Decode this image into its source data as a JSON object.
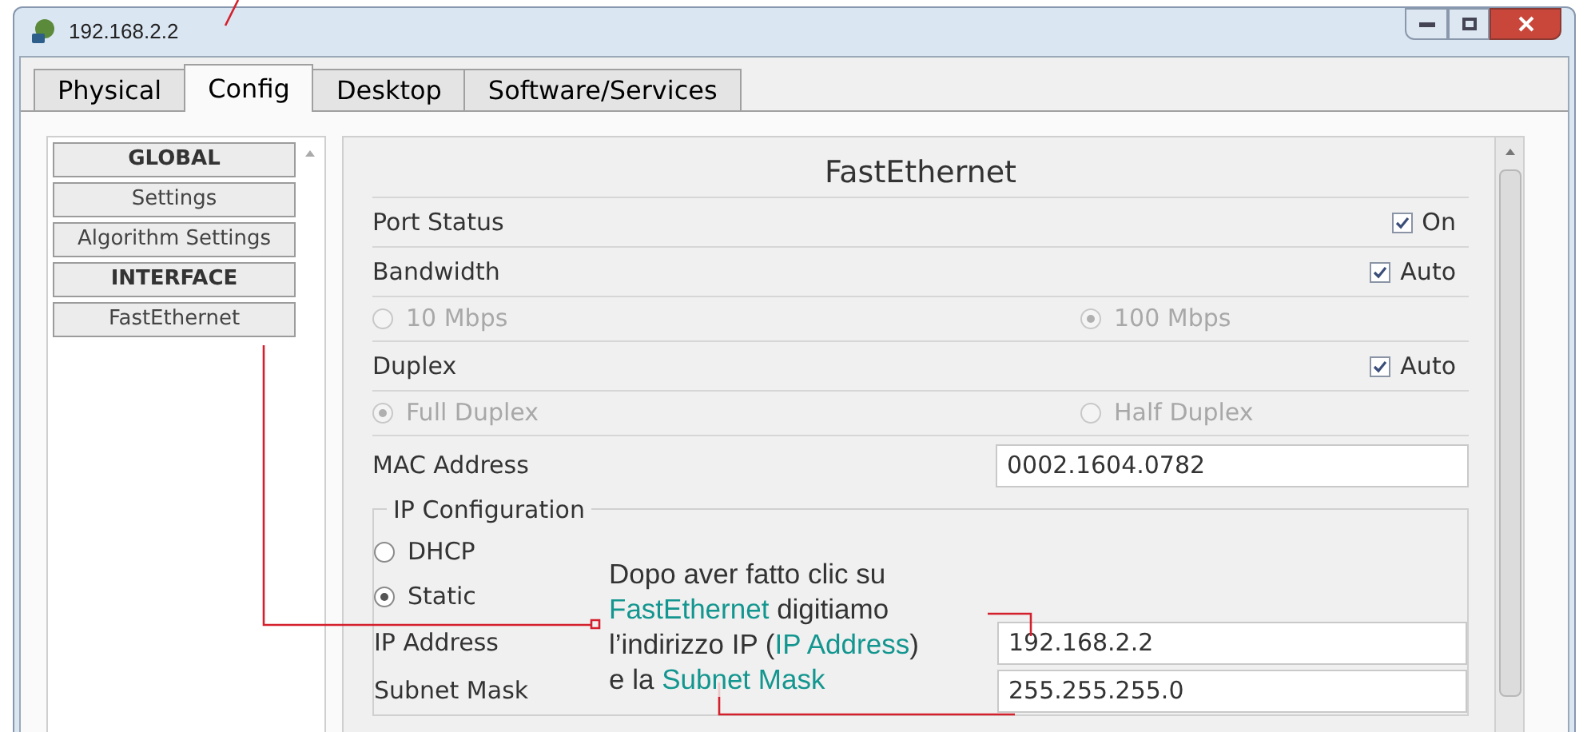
{
  "window": {
    "title": "192.168.2.2"
  },
  "tabs": [
    {
      "label": "Physical",
      "selected": false
    },
    {
      "label": "Config",
      "selected": true
    },
    {
      "label": "Desktop",
      "selected": false
    },
    {
      "label": "Software/Services",
      "selected": false
    }
  ],
  "sidebar": {
    "items": [
      {
        "label": "GLOBAL",
        "kind": "header"
      },
      {
        "label": "Settings",
        "kind": "button"
      },
      {
        "label": "Algorithm Settings",
        "kind": "button"
      },
      {
        "label": "INTERFACE",
        "kind": "header"
      },
      {
        "label": "FastEthernet",
        "kind": "button"
      }
    ]
  },
  "panel": {
    "title": "FastEthernet",
    "port_status": {
      "label": "Port Status",
      "option": "On",
      "checked": true
    },
    "bandwidth": {
      "label": "Bandwidth",
      "option": "Auto",
      "checked": true,
      "disabled": true,
      "choices": [
        {
          "label": "10 Mbps",
          "selected": false
        },
        {
          "label": "100 Mbps",
          "selected": true
        }
      ]
    },
    "duplex": {
      "label": "Duplex",
      "option": "Auto",
      "checked": true,
      "disabled": true,
      "choices": [
        {
          "label": "Full Duplex",
          "selected": true
        },
        {
          "label": "Half Duplex",
          "selected": false
        }
      ]
    },
    "mac": {
      "label": "MAC Address",
      "value": "0002.1604.0782"
    },
    "ip_configuration": {
      "title": "IP Configuration",
      "modes": [
        {
          "label": "DHCP",
          "selected": false
        },
        {
          "label": "Static",
          "selected": true
        }
      ],
      "fields": [
        {
          "label": "IP Address",
          "value": "192.168.2.2"
        },
        {
          "label": "Subnet Mask",
          "value": "255.255.255.0"
        }
      ]
    }
  },
  "callout": {
    "lines": [
      [
        {
          "text": "Dopo aver fatto clic su",
          "highlight": false
        }
      ],
      [
        {
          "text": "FastEthernet",
          "highlight": true
        },
        {
          "text": " digitiamo",
          "highlight": false
        }
      ],
      [
        {
          "text": "l’indirizzo IP (",
          "highlight": false
        },
        {
          "text": "IP Address",
          "highlight": true
        },
        {
          "text": ")",
          "highlight": false
        }
      ],
      [
        {
          "text": "e la ",
          "highlight": false
        },
        {
          "text": "Subnet Mask",
          "highlight": true
        }
      ]
    ]
  }
}
